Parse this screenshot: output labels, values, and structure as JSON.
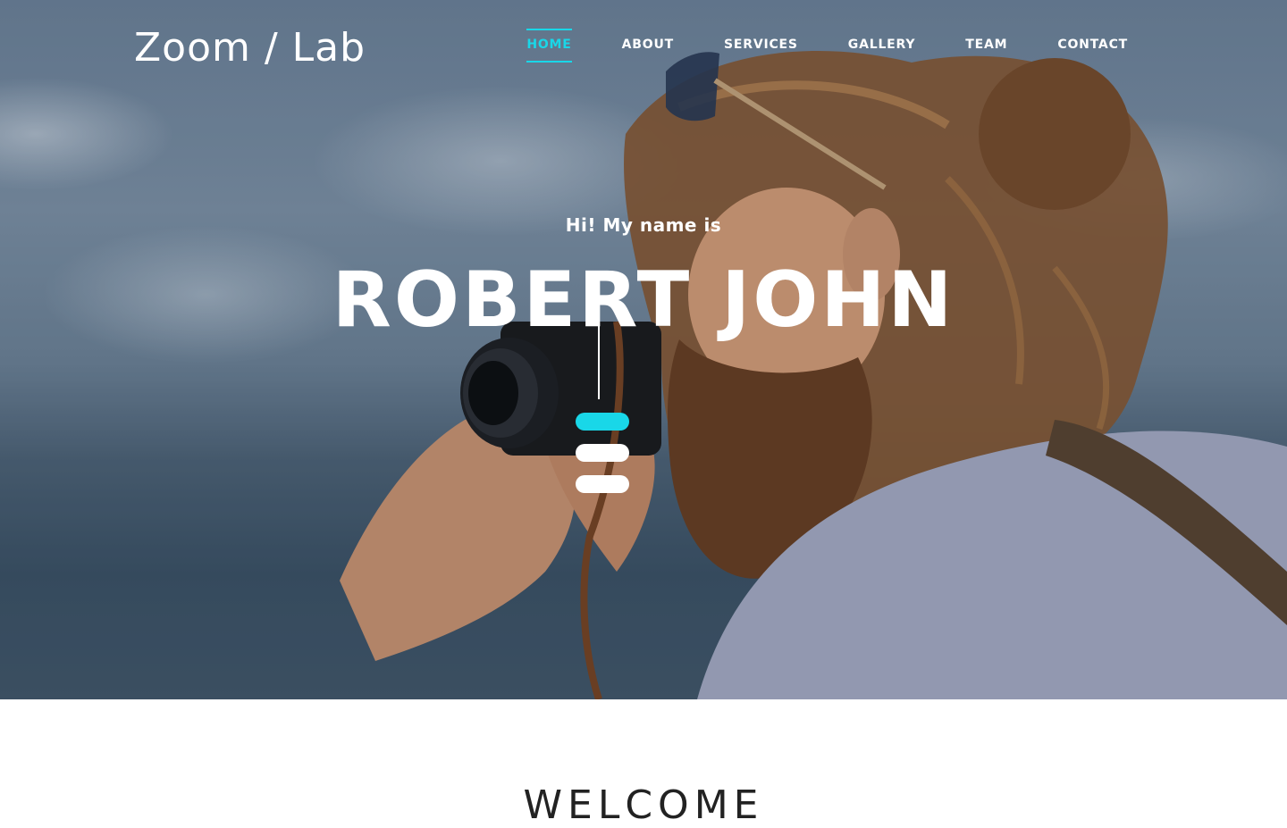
{
  "header": {
    "logo": "Zoom / Lab",
    "nav": [
      {
        "label": "HOME",
        "active": true
      },
      {
        "label": "ABOUT",
        "active": false
      },
      {
        "label": "SERVICES",
        "active": false
      },
      {
        "label": "GALLERY",
        "active": false
      },
      {
        "label": "TEAM",
        "active": false
      },
      {
        "label": "CONTACT",
        "active": false
      }
    ]
  },
  "hero": {
    "intro": "Hi! My name is",
    "name": "ROBERT JOHN",
    "slides": {
      "count": 3,
      "active_index": 0
    }
  },
  "welcome": {
    "heading": "WELCOME"
  },
  "colors": {
    "accent": "#19d7e8",
    "text_on_hero": "#ffffff",
    "heading_dark": "#222222"
  },
  "icons": {
    "slider_indicator": "pill-dot"
  }
}
